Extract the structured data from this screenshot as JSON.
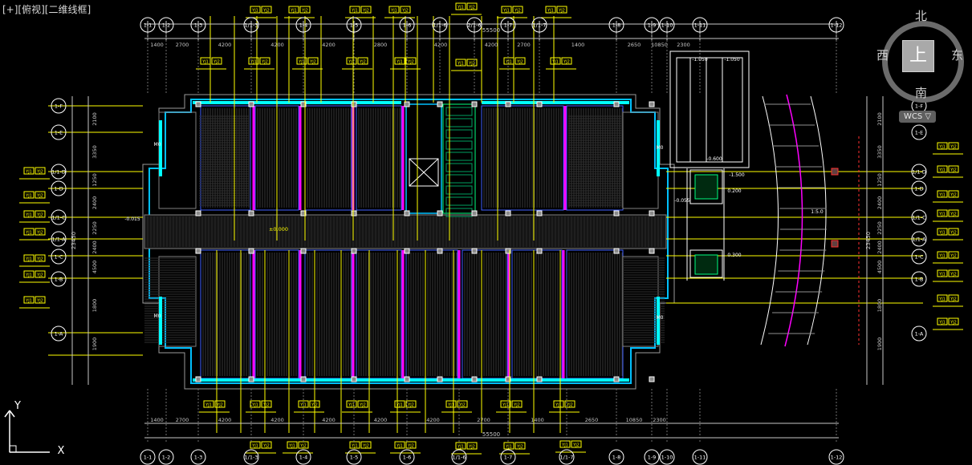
{
  "viewport": {
    "label": "[+][俯视][二维线框]"
  },
  "viewcube": {
    "north": "北",
    "south": "南",
    "west": "西",
    "east": "东",
    "face": "上",
    "wcs": "WCS ▽"
  },
  "ucs": {
    "y": "Y",
    "x": "X"
  },
  "colors": {
    "bg": "#000000",
    "axis": "#ffffff",
    "wall": "#00c0ff",
    "accent": "#ff00ff",
    "label": "#ffff00",
    "dim": "#c8c8c8",
    "window": "#00ffff",
    "red": "#ff3030"
  },
  "axes_top": [
    "1-1",
    "1-2",
    "1-3",
    "1/1-3",
    "1-4",
    "1-5",
    "1-6",
    "1/1-6",
    "2/1-6",
    "1-7",
    "1/1-7",
    "1-8",
    "1-9",
    "1-10",
    "1-11",
    "1-12"
  ],
  "axes_bottom": [
    "1-1",
    "1-2",
    "1-3",
    "1/1-3",
    "1-4",
    "1-5",
    "1-6",
    "1/1-6",
    "1-7",
    "1/1-7",
    "1-8",
    "1-9",
    "1-10",
    "1-11",
    "1-12"
  ],
  "axes_left": [
    "1-F",
    "1-E",
    "1/1-D",
    "1-D",
    "1/1-C",
    "1/1-A",
    "1-C",
    "1-B",
    "1-A"
  ],
  "axes_right": [
    "1-F",
    "1-E",
    "1/1-D",
    "1-D",
    "1/1-C",
    "1/1-A",
    "1-C",
    "1-B",
    "1-A"
  ],
  "dims_top": [
    "1400",
    "2700",
    "4200",
    "4200",
    "4200",
    "2800",
    "4200",
    "4200",
    "2700",
    "1400",
    "2650",
    "10850",
    "2300"
  ],
  "dims_bottom": [
    "1400",
    "2700",
    "4200",
    "4200",
    "4200",
    "4200",
    "4200",
    "2700",
    "1400",
    "2650",
    "10850",
    "2300"
  ],
  "dims_left": [
    "2100",
    "3350",
    "1250",
    "2400",
    "2250",
    "2400",
    "4500",
    "1800",
    "1900"
  ],
  "dims_right": [
    "2100",
    "3350",
    "1250",
    "2400",
    "2250",
    "2400",
    "4500",
    "1800",
    "1900"
  ],
  "total_top": "55500",
  "total_bottom": "55500",
  "total_side": "23450",
  "annotations": {
    "level_main": "±0.000",
    "level_a": "-0.015",
    "level_b": "0.200",
    "level_c": "-1.500",
    "level_d": "-0.600",
    "level_e": "-1.050",
    "level_f": "0.100",
    "level_g": "0.300",
    "level_h": "-0.055",
    "slope_note": "1:5.0",
    "door_m": "M0",
    "door_m2": "M0",
    "tag_a": "YJ1",
    "tag_b": "YJ2"
  }
}
